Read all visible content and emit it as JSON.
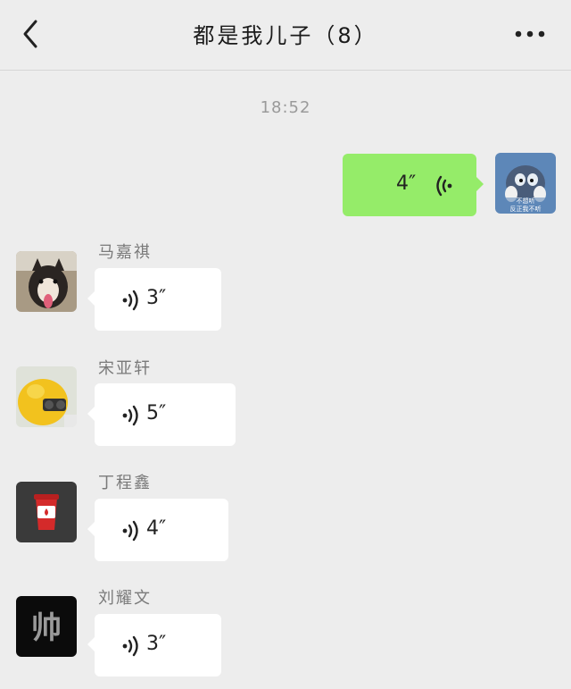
{
  "header": {
    "title": "都是我儿子（8）"
  },
  "time_label": "18:52",
  "messages": [
    {
      "sender": "",
      "duration": "4″",
      "direction": "out"
    },
    {
      "sender": "马嘉祺",
      "duration": "3″",
      "direction": "in"
    },
    {
      "sender": "宋亚轩",
      "duration": "5″",
      "direction": "in"
    },
    {
      "sender": "丁程鑫",
      "duration": "4″",
      "direction": "in"
    },
    {
      "sender": "刘耀文",
      "duration": "3″",
      "direction": "in"
    }
  ],
  "avatars": {
    "self_caption_1": "不想听",
    "self_caption_2": "反正我不听",
    "liu_glyph": "帅"
  },
  "colors": {
    "background": "#ededed",
    "incoming_bubble": "#ffffff",
    "outgoing_bubble": "#95ec69"
  }
}
